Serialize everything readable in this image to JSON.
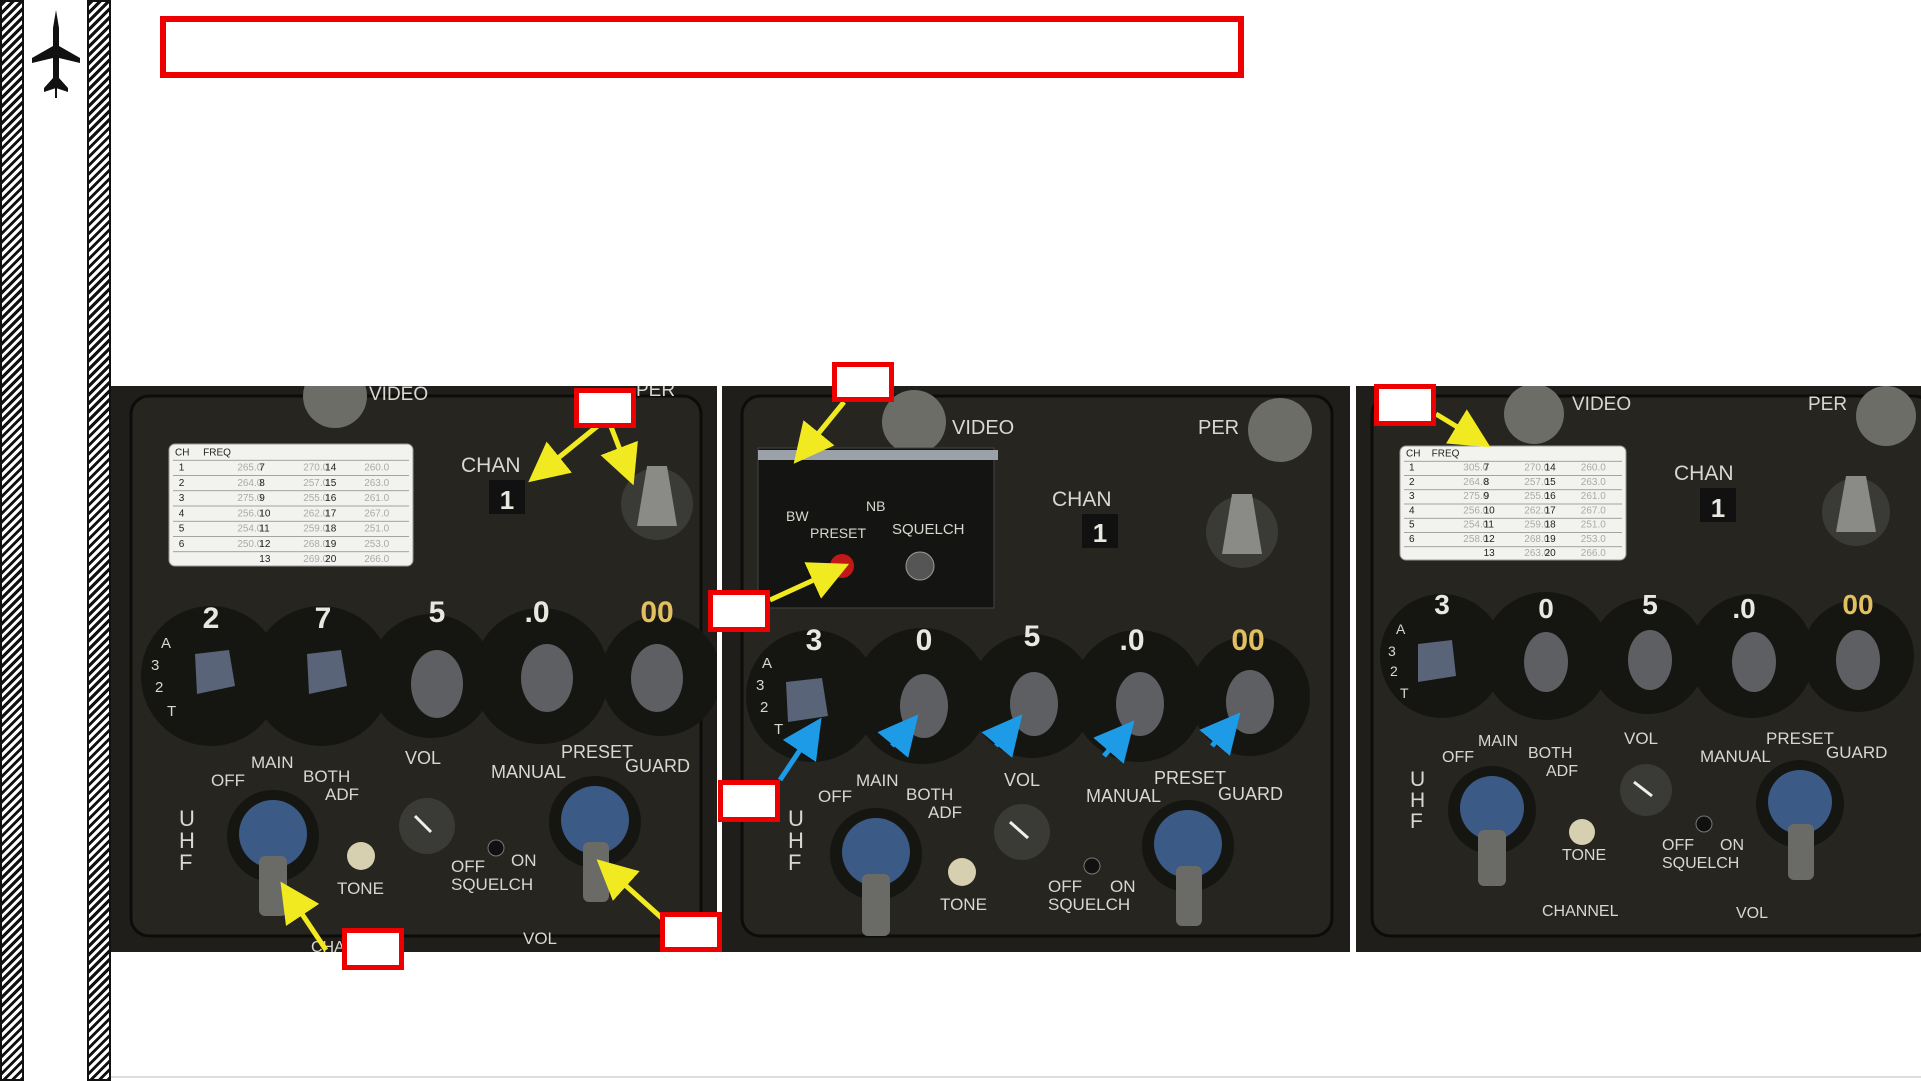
{
  "page": {
    "title_box_text": ""
  },
  "colors": {
    "callout_red": "#e00000",
    "arrow_yellow": "#f2ea20",
    "arrow_blue": "#1e9be6",
    "panel_bg": "#1b1a17"
  },
  "icons": {
    "logo": "fighter-jet-icon"
  },
  "panels": [
    {
      "id": "panel-1",
      "labels": {
        "video": "VIDEO",
        "per": "PER",
        "chan": "CHAN",
        "chan_value": "1",
        "off": "OFF",
        "main": "MAIN",
        "both": "BOTH",
        "adf": "ADF",
        "vol": "VOL",
        "manual": "MANUAL",
        "preset": "PRESET",
        "guard": "GUARD",
        "uhf": "UHF",
        "tone": "TONE",
        "squelch_off": "OFF",
        "squelch_on": "ON",
        "squelch": "SQUELCH",
        "channel": "CHANNEL",
        "vol2": "VOL"
      },
      "freq_digits": [
        "2",
        "7",
        "5",
        ".0",
        "00"
      ],
      "selector_letters": [
        "A",
        "3",
        "2",
        "T"
      ],
      "table": {
        "headers": [
          "CH",
          "FREQ"
        ],
        "rows": [
          [
            "1",
            "265.0",
            "7",
            "270.0",
            "14",
            "260.0"
          ],
          [
            "2",
            "264.0",
            "8",
            "257.0",
            "15",
            "263.0"
          ],
          [
            "3",
            "275.0",
            "9",
            "255.0",
            "16",
            "261.0"
          ],
          [
            "4",
            "256.0",
            "10",
            "262.0",
            "17",
            "267.0"
          ],
          [
            "5",
            "254.0",
            "11",
            "259.0",
            "18",
            "251.0"
          ],
          [
            "6",
            "250.0",
            "12",
            "268.0",
            "19",
            "253.0"
          ],
          [
            "",
            "",
            "13",
            "269.0",
            "20",
            "266.0"
          ]
        ]
      }
    },
    {
      "id": "panel-2",
      "labels": {
        "video": "VIDEO",
        "per": "PER",
        "chan": "CHAN",
        "chan_value": "1",
        "bw": "BW",
        "nb": "NB",
        "preset": "PRESET",
        "squelch": "SQUELCH",
        "off": "OFF",
        "main": "MAIN",
        "both": "BOTH",
        "adf": "ADF",
        "vol": "VOL",
        "manual": "MANUAL",
        "preset2": "PRESET",
        "guard": "GUARD",
        "uhf": "UHF",
        "tone": "TONE",
        "squelch_off": "OFF",
        "squelch_on": "ON",
        "squelch2": "SQUELCH"
      },
      "freq_digits": [
        "3",
        "0",
        "5",
        ".0",
        "00"
      ],
      "selector_letters": [
        "A",
        "3",
        "2",
        "T"
      ]
    },
    {
      "id": "panel-3",
      "labels": {
        "video": "VIDEO",
        "per": "PER",
        "chan": "CHAN",
        "chan_value": "1",
        "off": "OFF",
        "main": "MAIN",
        "both": "BOTH",
        "adf": "ADF",
        "vol": "VOL",
        "manual": "MANUAL",
        "preset": "PRESET",
        "guard": "GUARD",
        "uhf": "UHF",
        "tone": "TONE",
        "squelch_off": "OFF",
        "squelch_on": "ON",
        "squelch": "SQUELCH",
        "channel": "CHANNEL",
        "vol2": "VOL"
      },
      "freq_digits": [
        "3",
        "0",
        "5",
        ".0",
        "00"
      ],
      "selector_letters": [
        "A",
        "3",
        "2",
        "T"
      ],
      "table": {
        "headers": [
          "CH",
          "FREQ"
        ],
        "rows": [
          [
            "1",
            "305.0",
            "7",
            "270.0",
            "14",
            "260.0"
          ],
          [
            "2",
            "264.0",
            "8",
            "257.0",
            "15",
            "263.0"
          ],
          [
            "3",
            "275.0",
            "9",
            "255.0",
            "16",
            "261.0"
          ],
          [
            "4",
            "256.0",
            "10",
            "262.0",
            "17",
            "267.0"
          ],
          [
            "5",
            "254.0",
            "11",
            "259.0",
            "18",
            "251.0"
          ],
          [
            "6",
            "258.0",
            "12",
            "268.0",
            "19",
            "253.0"
          ],
          [
            "",
            "",
            "13",
            "263.0",
            "20",
            "266.0"
          ]
        ]
      }
    }
  ]
}
